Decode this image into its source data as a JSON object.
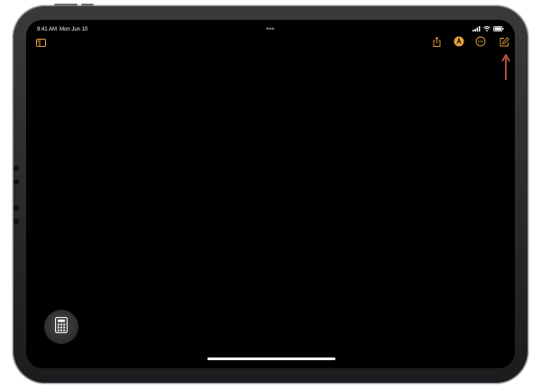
{
  "status_bar": {
    "time": "9:41 AM",
    "date": "Mon Jun 10",
    "multitask_dots": "•••",
    "signal_icon": "cellular-signal-icon",
    "wifi_icon": "wifi-icon",
    "battery_icon": "battery-icon"
  },
  "toolbar": {
    "sidebar_icon": "sidebar-toggle-icon",
    "share_icon": "share-icon",
    "markup_icon": "markup-pen-icon",
    "more_icon": "more-ellipsis-icon",
    "compose_icon": "compose-icon"
  },
  "annotation": {
    "arrow_color": "#e0604f"
  },
  "floating": {
    "calculator_icon": "calculator-icon"
  },
  "colors": {
    "accent": "#e6a23c",
    "background": "#000000",
    "bezel": "#2c2c2e"
  }
}
